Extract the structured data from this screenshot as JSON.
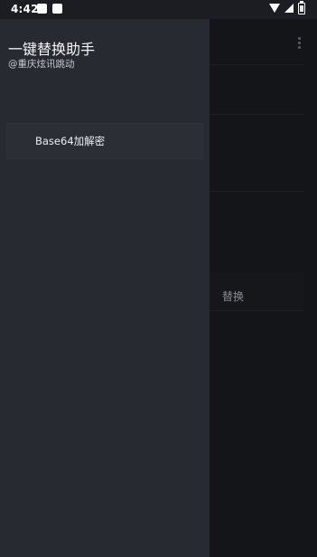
{
  "status_bar": {
    "time": "4:42"
  },
  "drawer": {
    "title": "一键替换助手",
    "subtitle": "@重庆炫讯跳动",
    "items": [
      {
        "label": "Base64加解密"
      }
    ]
  },
  "main": {
    "replace_label": "替换",
    "menu_icon": "more-vertical-icon"
  },
  "colors": {
    "drawer_background": "#272a31",
    "main_background": "#141518",
    "status_bar_background": "#1b1d22"
  }
}
